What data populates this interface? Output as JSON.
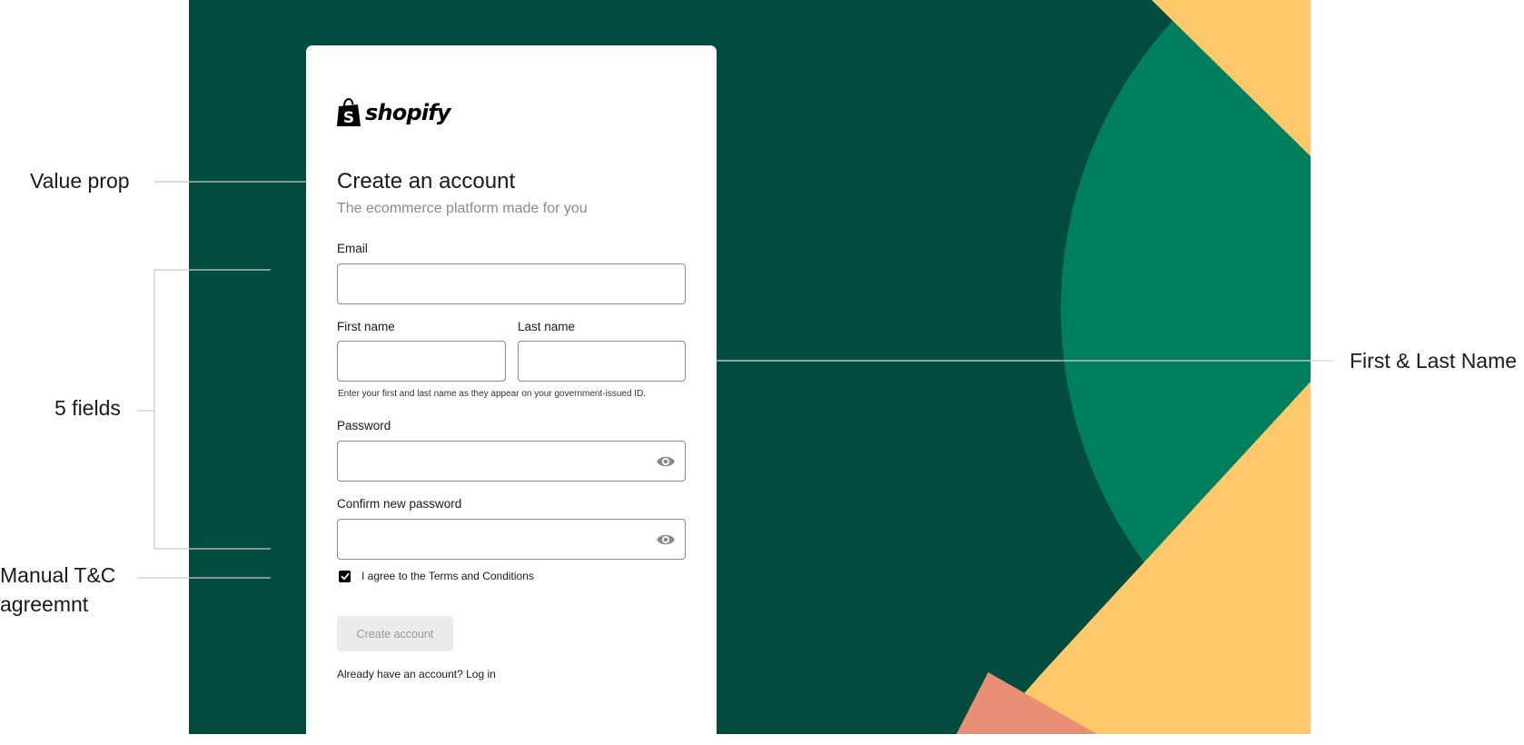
{
  "brand": {
    "logo_text": "shopify",
    "colors": {
      "background_dark": "#024c3f",
      "circle_green": "#007f5f",
      "accent_yellow": "#ffc96b",
      "accent_salmon": "#f4a582",
      "card": "#ffffff"
    }
  },
  "form": {
    "title": "Create an account",
    "subtitle": "The ecommerce platform made for you",
    "email": {
      "label": "Email",
      "value": "",
      "placeholder": ""
    },
    "first_name": {
      "label": "First name",
      "value": "",
      "placeholder": ""
    },
    "last_name": {
      "label": "Last name",
      "value": "",
      "placeholder": ""
    },
    "name_help": "Enter your first and last name as they appear on your government-issued ID.",
    "password": {
      "label": "Password",
      "value": "",
      "placeholder": "",
      "icon": "eye-icon"
    },
    "confirm_password": {
      "label": "Confirm new password",
      "value": "",
      "placeholder": "",
      "icon": "eye-icon"
    },
    "terms": {
      "label": "I agree to the Terms and Conditions",
      "checked": true
    },
    "submit_label": "Create account",
    "login_prompt": "Already have an account?",
    "login_link": "Log in"
  },
  "annotations": {
    "value_prop": "Value prop",
    "fields": "5 fields",
    "terms_line1": "Manual T&C",
    "terms_line2": "agreemnt",
    "name": "First & Last Name"
  }
}
